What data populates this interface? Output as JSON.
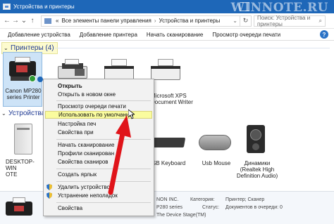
{
  "window": {
    "title": "Устройства и принтеры",
    "watermark": "WINNOTE.RU"
  },
  "address": {
    "sep1": "«",
    "path1": "Все элементы панели управления",
    "sep2": "›",
    "path2": "Устройства и принтеры",
    "chevron": "⌄",
    "refresh": "↻",
    "search_placeholder": "Поиск: Устройства и принтеры",
    "search_icon": "⌕"
  },
  "nav": {
    "back": "←",
    "forward": "→",
    "dropdown": "⌄",
    "up": "↑"
  },
  "toolbar": {
    "add_device": "Добавление устройства",
    "add_printer": "Добавление принтера",
    "start_scan": "Начать сканирование",
    "print_queue": "Просмотр очереди печати",
    "help": "?"
  },
  "groups": {
    "printers": "Принтеры (4)",
    "devices": "Устройства",
    "chevron": "⌄"
  },
  "printers": [
    {
      "line1": "Canon MP280",
      "line2": "series Printer"
    },
    {
      "line1": "",
      "line2": ""
    },
    {
      "line1": "",
      "line2": ""
    },
    {
      "line1": "Microsoft XPS",
      "line2": "Document Writer"
    }
  ],
  "devices": [
    {
      "line1": "DESKTOP-WIN",
      "line2": "OTE"
    },
    {
      "line1": "",
      "line2": ""
    },
    {
      "line1": "",
      "line2": ""
    },
    {
      "line1": "SB Keyboard",
      "line2": ""
    },
    {
      "line1": "Usb Mouse",
      "line2": ""
    },
    {
      "line1": "Динамики",
      "line2": "(Realtek High",
      "line3": "Definition Audio)"
    }
  ],
  "context_menu": {
    "items": [
      "Открыть",
      "Открыть в новом окне",
      "Просмотр очереди печати",
      "Использовать по умолчанию",
      "Настройка печ",
      "Свойства при",
      "Начать сканирование",
      "Профили сканирован",
      "Свойства сканиров",
      "Создать ярлык",
      "Удалить устройство",
      "Устранение неполадок",
      "Свойства"
    ]
  },
  "details": {
    "manufacturer_value": "NON INC.",
    "model_value": "P280 series",
    "desc_value": "The Device Stage(TM)",
    "category_key": "Категория:",
    "category_value": "Принтер; Сканер",
    "status_key": "Статус:",
    "status_value": "Документов в очереди: 0"
  },
  "colors": {
    "titlebar": "#1e67b8",
    "highlight": "#fafc9e",
    "selection": "#cde3f7",
    "arrow": "#e0141a"
  }
}
